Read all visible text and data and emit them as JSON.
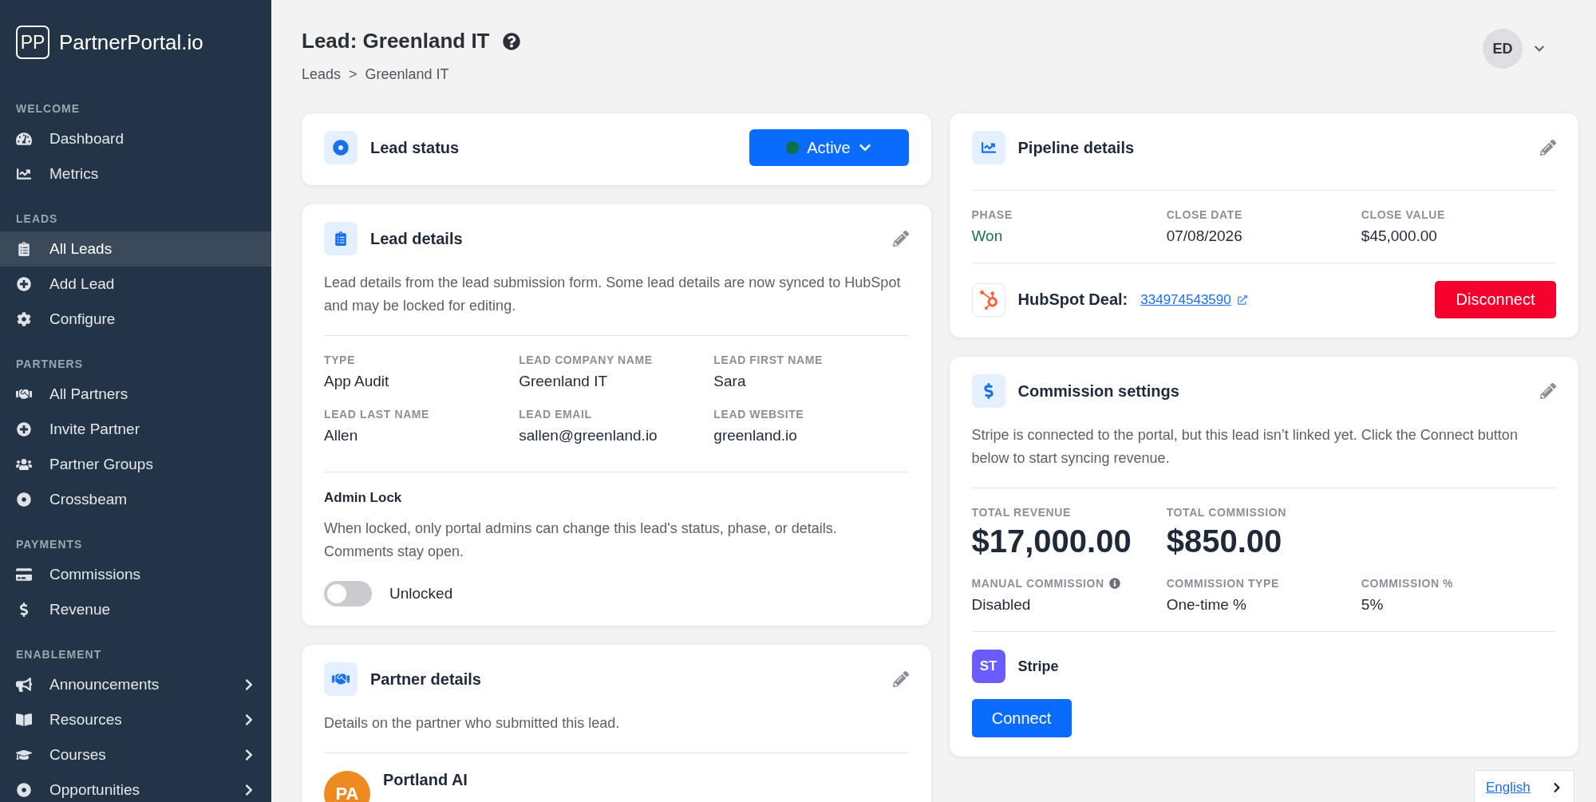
{
  "sidebar": {
    "logo_mark": "PP",
    "brand": "PartnerPortal.io",
    "sections": [
      {
        "title": "WELCOME",
        "items": [
          {
            "label": "Dashboard",
            "selected": false,
            "expandable": false
          },
          {
            "label": "Metrics",
            "selected": false,
            "expandable": false
          }
        ]
      },
      {
        "title": "LEADS",
        "items": [
          {
            "label": "All Leads",
            "selected": true,
            "expandable": false
          },
          {
            "label": "Add Lead",
            "selected": false,
            "expandable": false
          },
          {
            "label": "Configure",
            "selected": false,
            "expandable": false
          }
        ]
      },
      {
        "title": "PARTNERS",
        "items": [
          {
            "label": "All Partners",
            "selected": false,
            "expandable": false
          },
          {
            "label": "Invite Partner",
            "selected": false,
            "expandable": false
          },
          {
            "label": "Partner Groups",
            "selected": false,
            "expandable": false
          },
          {
            "label": "Crossbeam",
            "selected": false,
            "expandable": false
          }
        ]
      },
      {
        "title": "PAYMENTS",
        "items": [
          {
            "label": "Commissions",
            "selected": false,
            "expandable": false
          },
          {
            "label": "Revenue",
            "selected": false,
            "expandable": false
          }
        ]
      },
      {
        "title": "ENABLEMENT",
        "items": [
          {
            "label": "Announcements",
            "selected": false,
            "expandable": true
          },
          {
            "label": "Resources",
            "selected": false,
            "expandable": true
          },
          {
            "label": "Courses",
            "selected": false,
            "expandable": true
          },
          {
            "label": "Opportunities",
            "selected": false,
            "expandable": true
          }
        ]
      }
    ]
  },
  "header": {
    "title": "Lead: Greenland IT",
    "breadcrumb": [
      "Leads",
      ">",
      "Greenland IT"
    ],
    "user_initials": "ED"
  },
  "lead_status": {
    "title": "Lead status",
    "status": "Active"
  },
  "lead_details": {
    "title": "Lead details",
    "description": "Lead details from the lead submission form. Some lead details are now synced to HubSpot and may be locked for editing.",
    "fields": [
      {
        "label": "TYPE",
        "value": "App Audit"
      },
      {
        "label": "LEAD COMPANY NAME",
        "value": "Greenland IT"
      },
      {
        "label": "LEAD FIRST NAME",
        "value": "Sara"
      },
      {
        "label": "LEAD LAST NAME",
        "value": "Allen"
      },
      {
        "label": "LEAD EMAIL",
        "value": "sallen@greenland.io"
      },
      {
        "label": "LEAD WEBSITE",
        "value": "greenland.io"
      }
    ],
    "admin_lock": {
      "title": "Admin Lock",
      "description": "When locked, only portal admins can change this lead's status, phase, or details. Comments stay open.",
      "on": false,
      "label": "Unlocked"
    }
  },
  "partner_details": {
    "title": "Partner details",
    "description": "Details on the partner who submitted this lead.",
    "partner": {
      "initials": "PA",
      "name": "Portland AI"
    }
  },
  "pipeline": {
    "title": "Pipeline details",
    "fields": [
      {
        "label": "PHASE",
        "value": "Won",
        "highlight": true
      },
      {
        "label": "CLOSE DATE",
        "value": "07/08/2026",
        "highlight": false
      },
      {
        "label": "CLOSE VALUE",
        "value": "$45,000.00",
        "highlight": false
      }
    ],
    "deal": {
      "label": "HubSpot Deal:",
      "id": "334974543590",
      "button": "Disconnect"
    }
  },
  "commission": {
    "title": "Commission settings",
    "description": "Stripe is connected to the portal, but this lead isn’t linked yet. Click the Connect button below to start syncing revenue.",
    "totals": [
      {
        "label": "TOTAL REVENUE",
        "value": "$17,000.00"
      },
      {
        "label": "TOTAL COMMISSION",
        "value": "$850.00"
      }
    ],
    "fields": [
      {
        "label": "MANUAL COMMISSION",
        "value": "Disabled",
        "info": true
      },
      {
        "label": "COMMISSION TYPE",
        "value": "One-time %",
        "info": false
      },
      {
        "label": "COMMISSION %",
        "value": "5%",
        "info": false
      }
    ],
    "integration": {
      "initials": "ST",
      "name": "Stripe"
    },
    "button": "Connect"
  },
  "language": {
    "label": "English"
  }
}
